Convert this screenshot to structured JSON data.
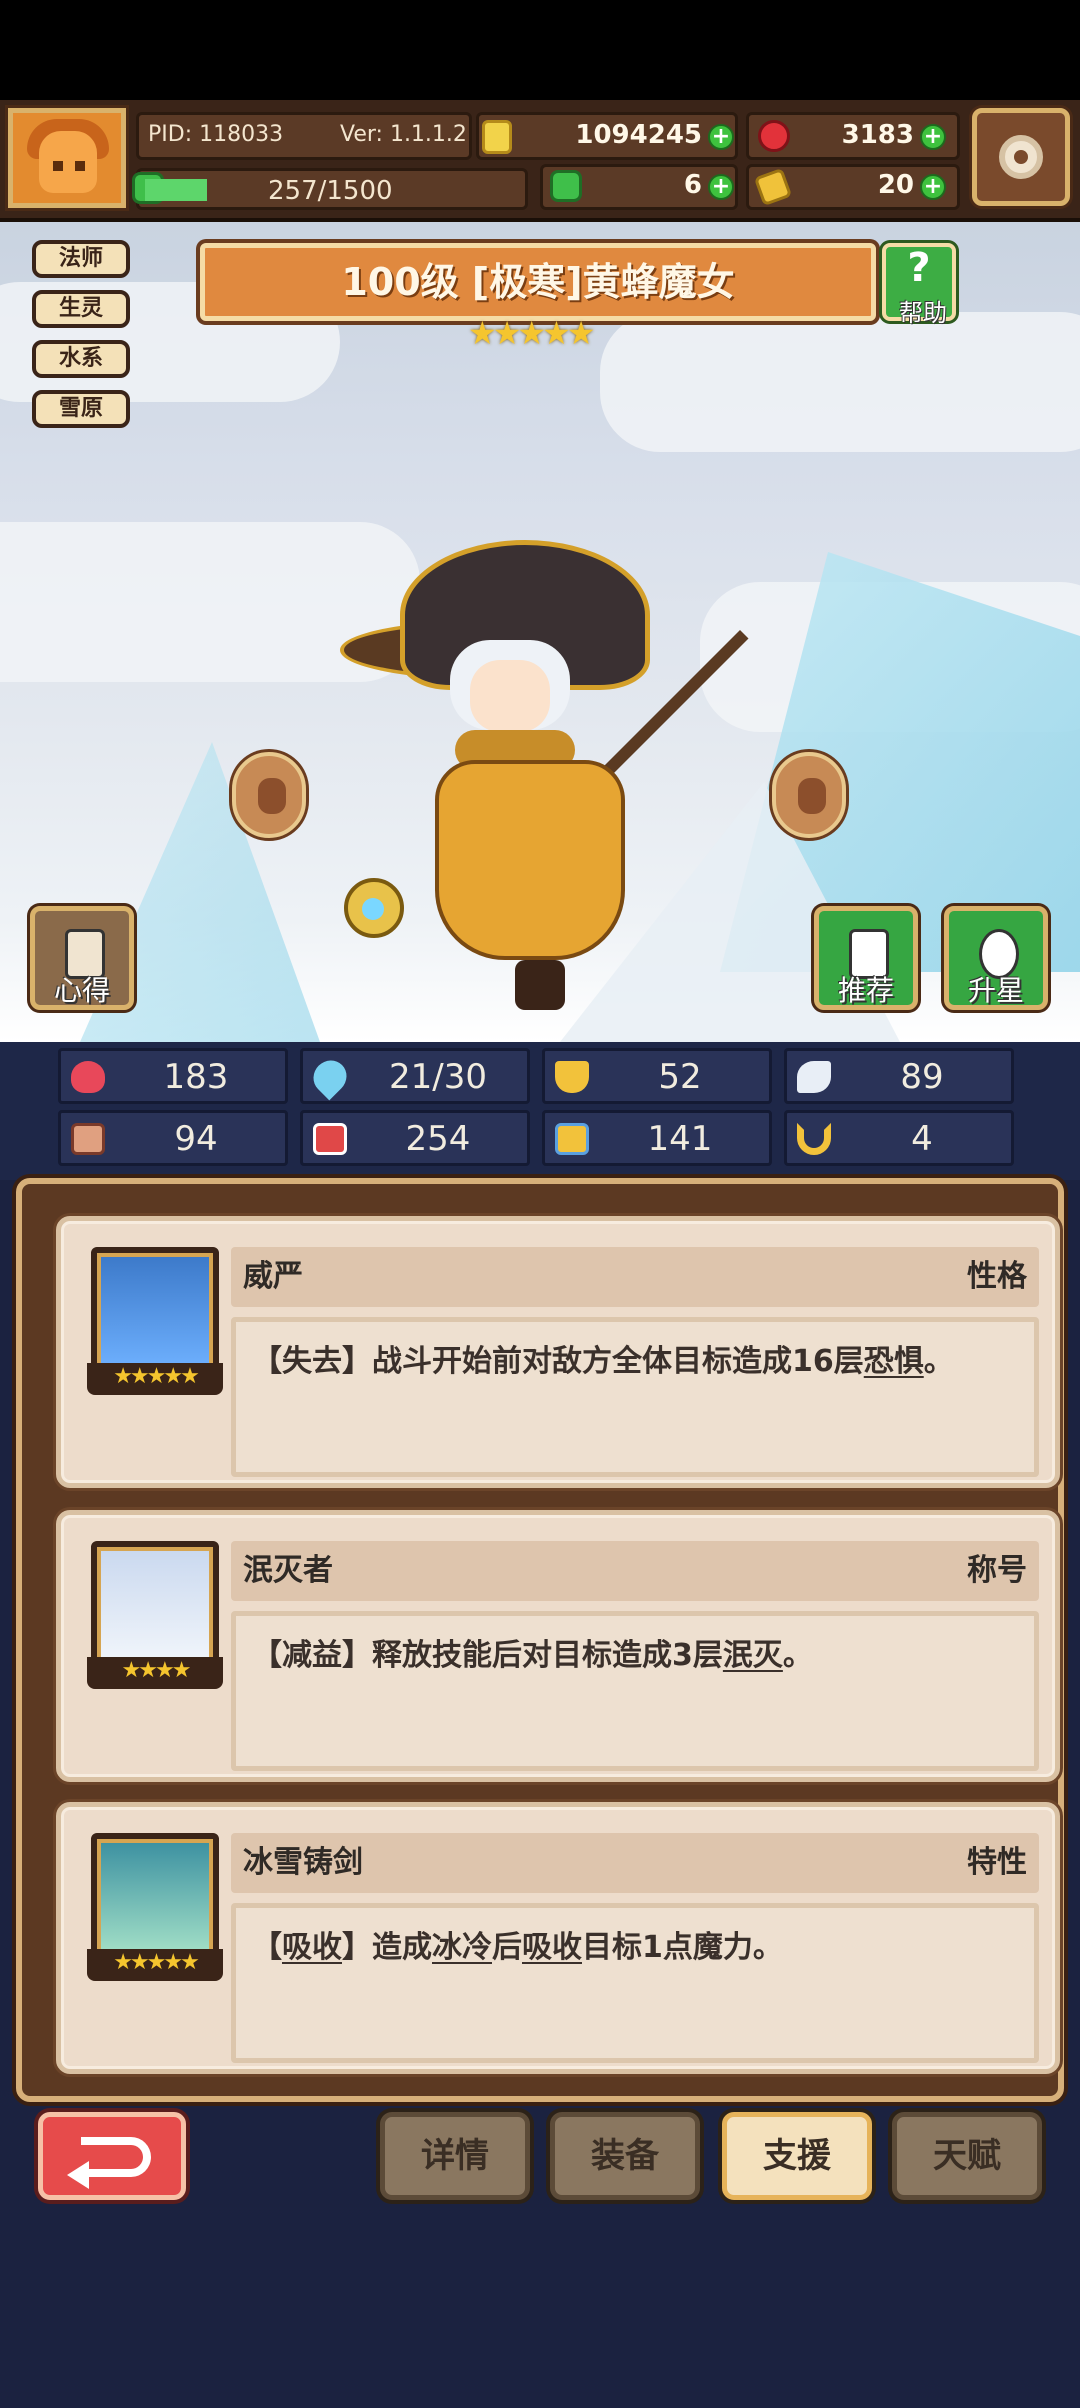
{
  "header": {
    "pid": "PID: 118033",
    "version": "Ver: 1.1.1.2",
    "stamina": "257/1500",
    "gold": "1094245",
    "gems": "3183",
    "clover": "6",
    "fist": "20",
    "stamina_fraction": 0.171
  },
  "hero": {
    "title": "100级 [极寒]黄蜂魔女",
    "stars": "★★★★★",
    "tags": [
      "法师",
      "生灵",
      "水系",
      "雪原"
    ],
    "help_label": "帮助",
    "left_button_label": "心得",
    "recommend_label": "推荐",
    "upgrade_label": "升星"
  },
  "stats": [
    {
      "icon": "heart-icon",
      "value": "183",
      "color": "#e8485a"
    },
    {
      "icon": "water-drop-icon",
      "value": "21/30",
      "color": "#7ad1f0"
    },
    {
      "icon": "shield-icon",
      "value": "52",
      "color": "#f2c23b"
    },
    {
      "icon": "wing-icon",
      "value": "89",
      "color": "#e8eef6"
    },
    {
      "icon": "fist-icon",
      "value": "94",
      "color": "#e0a080"
    },
    {
      "icon": "book-icon",
      "value": "254",
      "color": "#e04848"
    },
    {
      "icon": "boot-icon",
      "value": "141",
      "color": "#5aa0e0"
    },
    {
      "icon": "horseshoe-icon",
      "value": "4",
      "color": "#f2c23b"
    }
  ],
  "cards": [
    {
      "name": "威严",
      "kind": "性格",
      "stars": "★★★★★",
      "desc": "【失去】战斗开始前对敌方全体目标造成16层恐惧。"
    },
    {
      "name": "泯灭者",
      "kind": "称号",
      "stars": "★★★★",
      "desc": "【减益】释放技能后对目标造成3层泯灭。"
    },
    {
      "name": "冰雪铸剑",
      "kind": "特性",
      "stars": "★★★★★",
      "desc": "【吸收】造成冰冷后吸收目标1点魔力。"
    }
  ],
  "nav": {
    "details": "详情",
    "equipment": "装备",
    "support": "支援",
    "talent": "天赋",
    "active": "support"
  }
}
